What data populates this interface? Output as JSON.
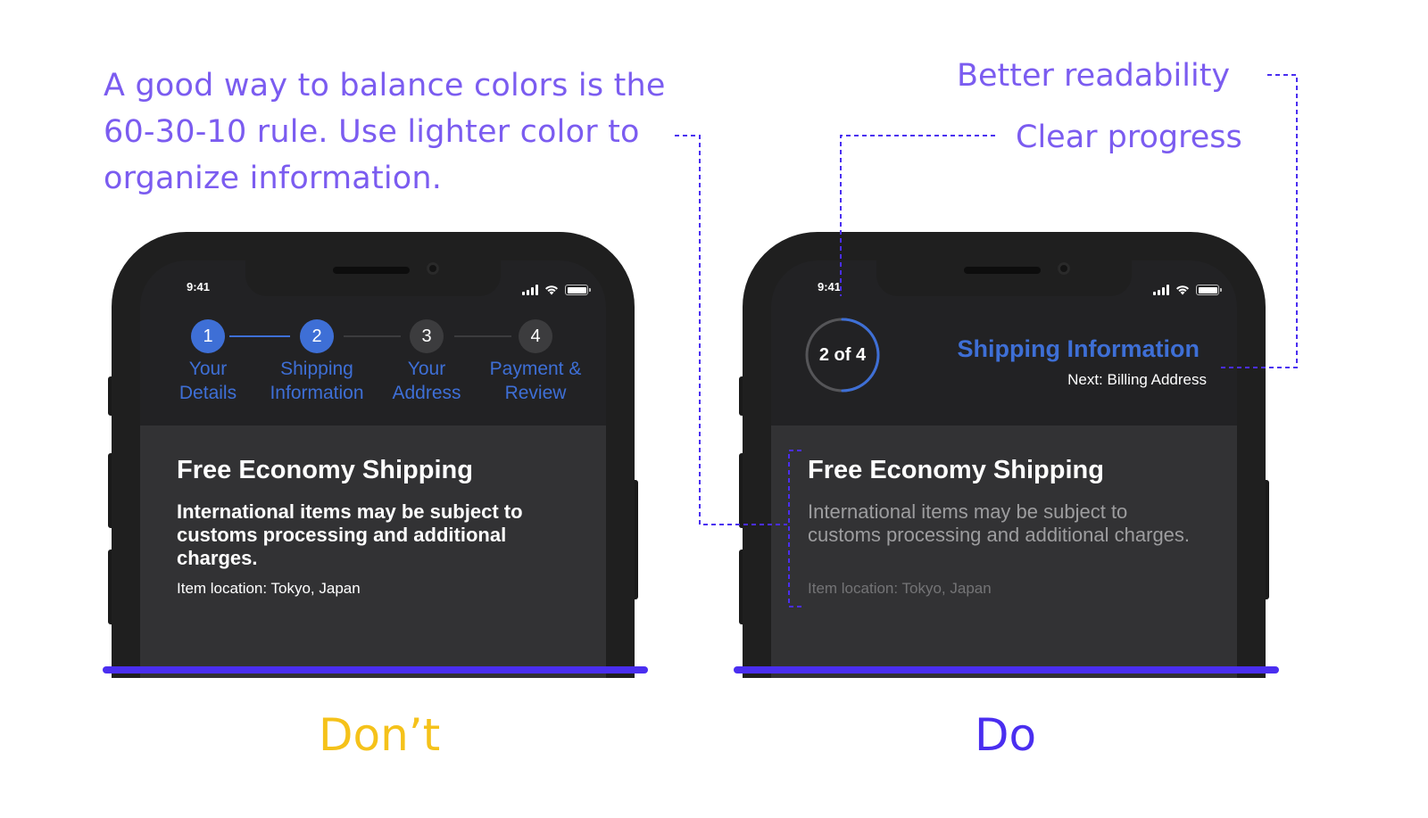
{
  "annotations": {
    "main_text": "A good way to balance colors is the 60-30-10 rule. Use lighter color to organize information.",
    "better_readability": "Better readability",
    "clear_progress": "Clear progress"
  },
  "captions": {
    "dont": "Don’t",
    "do": "Do"
  },
  "colors": {
    "annotation": "#7b5cf0",
    "dont": "#f5c21a",
    "do": "#4a2ef0",
    "accent_blue": "#3e6fd6",
    "screen_bg": "#222224",
    "card_bg": "#323234"
  },
  "dont_phone": {
    "status": {
      "time": "9:41",
      "icons": [
        "signal-icon",
        "wifi-icon",
        "battery-icon"
      ]
    },
    "steps": [
      {
        "number": "1",
        "label": "Your Details",
        "active": true
      },
      {
        "number": "2",
        "label": "Shipping Information",
        "active": true
      },
      {
        "number": "3",
        "label": "Your Address",
        "active": false
      },
      {
        "number": "4",
        "label": "Payment & Review",
        "active": false
      }
    ],
    "card": {
      "title": "Free Economy Shipping",
      "body": "International items may be subject to customs processing and additional charges.",
      "location": "Item location: Tokyo, Japan"
    }
  },
  "do_phone": {
    "status": {
      "time": "9:41",
      "icons": [
        "signal-icon",
        "wifi-icon",
        "battery-icon"
      ]
    },
    "progress": {
      "label": "2 of 4",
      "current": 2,
      "total": 4
    },
    "header": {
      "title": "Shipping Information",
      "next": "Next: Billing Address"
    },
    "card": {
      "title": "Free Economy Shipping",
      "body": "International items may be subject to customs processing and additional charges.",
      "location": "Item location: Tokyo, Japan"
    }
  }
}
